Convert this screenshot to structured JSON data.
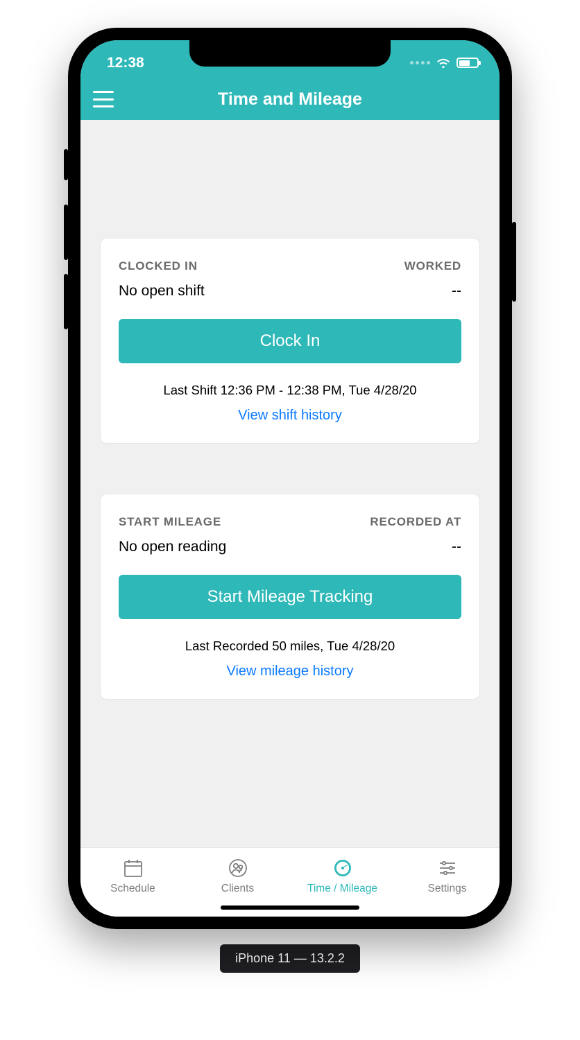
{
  "status": {
    "time": "12:38"
  },
  "header": {
    "title": "Time and Mileage"
  },
  "shift_card": {
    "left_label": "CLOCKED IN",
    "right_label": "WORKED",
    "left_value": "No open shift",
    "right_value": "--",
    "button": "Clock In",
    "last": "Last Shift 12:36 PM - 12:38 PM, Tue 4/28/20",
    "link": "View shift history"
  },
  "mileage_card": {
    "left_label": "START MILEAGE",
    "right_label": "RECORDED AT",
    "left_value": "No open reading",
    "right_value": "--",
    "button": "Start Mileage Tracking",
    "last": "Last Recorded 50 miles, Tue 4/28/20",
    "link": "View mileage history"
  },
  "tabs": {
    "schedule": "Schedule",
    "clients": "Clients",
    "time": "Time / Mileage",
    "settings": "Settings"
  },
  "device_label": "iPhone 11 — 13.2.2"
}
